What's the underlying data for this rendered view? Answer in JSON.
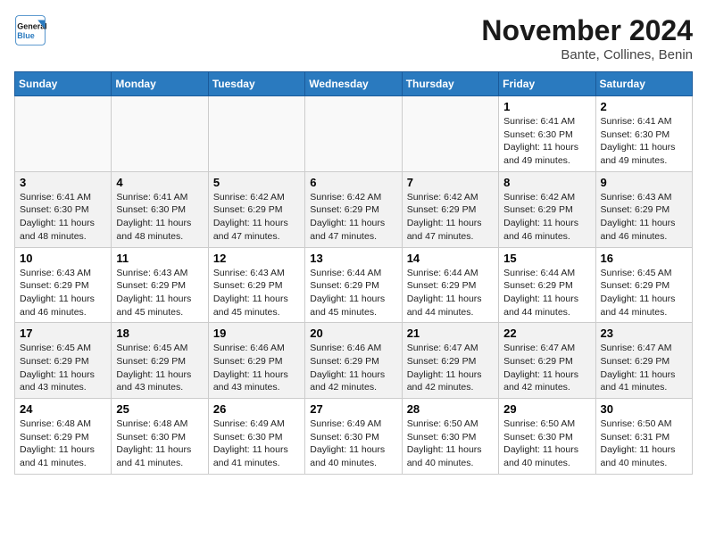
{
  "logo": {
    "line1": "General",
    "line2": "Blue"
  },
  "title": "November 2024",
  "location": "Bante, Collines, Benin",
  "weekdays": [
    "Sunday",
    "Monday",
    "Tuesday",
    "Wednesday",
    "Thursday",
    "Friday",
    "Saturday"
  ],
  "weeks": [
    [
      {
        "day": "",
        "info": ""
      },
      {
        "day": "",
        "info": ""
      },
      {
        "day": "",
        "info": ""
      },
      {
        "day": "",
        "info": ""
      },
      {
        "day": "",
        "info": ""
      },
      {
        "day": "1",
        "info": "Sunrise: 6:41 AM\nSunset: 6:30 PM\nDaylight: 11 hours and 49 minutes."
      },
      {
        "day": "2",
        "info": "Sunrise: 6:41 AM\nSunset: 6:30 PM\nDaylight: 11 hours and 49 minutes."
      }
    ],
    [
      {
        "day": "3",
        "info": "Sunrise: 6:41 AM\nSunset: 6:30 PM\nDaylight: 11 hours and 48 minutes."
      },
      {
        "day": "4",
        "info": "Sunrise: 6:41 AM\nSunset: 6:30 PM\nDaylight: 11 hours and 48 minutes."
      },
      {
        "day": "5",
        "info": "Sunrise: 6:42 AM\nSunset: 6:29 PM\nDaylight: 11 hours and 47 minutes."
      },
      {
        "day": "6",
        "info": "Sunrise: 6:42 AM\nSunset: 6:29 PM\nDaylight: 11 hours and 47 minutes."
      },
      {
        "day": "7",
        "info": "Sunrise: 6:42 AM\nSunset: 6:29 PM\nDaylight: 11 hours and 47 minutes."
      },
      {
        "day": "8",
        "info": "Sunrise: 6:42 AM\nSunset: 6:29 PM\nDaylight: 11 hours and 46 minutes."
      },
      {
        "day": "9",
        "info": "Sunrise: 6:43 AM\nSunset: 6:29 PM\nDaylight: 11 hours and 46 minutes."
      }
    ],
    [
      {
        "day": "10",
        "info": "Sunrise: 6:43 AM\nSunset: 6:29 PM\nDaylight: 11 hours and 46 minutes."
      },
      {
        "day": "11",
        "info": "Sunrise: 6:43 AM\nSunset: 6:29 PM\nDaylight: 11 hours and 45 minutes."
      },
      {
        "day": "12",
        "info": "Sunrise: 6:43 AM\nSunset: 6:29 PM\nDaylight: 11 hours and 45 minutes."
      },
      {
        "day": "13",
        "info": "Sunrise: 6:44 AM\nSunset: 6:29 PM\nDaylight: 11 hours and 45 minutes."
      },
      {
        "day": "14",
        "info": "Sunrise: 6:44 AM\nSunset: 6:29 PM\nDaylight: 11 hours and 44 minutes."
      },
      {
        "day": "15",
        "info": "Sunrise: 6:44 AM\nSunset: 6:29 PM\nDaylight: 11 hours and 44 minutes."
      },
      {
        "day": "16",
        "info": "Sunrise: 6:45 AM\nSunset: 6:29 PM\nDaylight: 11 hours and 44 minutes."
      }
    ],
    [
      {
        "day": "17",
        "info": "Sunrise: 6:45 AM\nSunset: 6:29 PM\nDaylight: 11 hours and 43 minutes."
      },
      {
        "day": "18",
        "info": "Sunrise: 6:45 AM\nSunset: 6:29 PM\nDaylight: 11 hours and 43 minutes."
      },
      {
        "day": "19",
        "info": "Sunrise: 6:46 AM\nSunset: 6:29 PM\nDaylight: 11 hours and 43 minutes."
      },
      {
        "day": "20",
        "info": "Sunrise: 6:46 AM\nSunset: 6:29 PM\nDaylight: 11 hours and 42 minutes."
      },
      {
        "day": "21",
        "info": "Sunrise: 6:47 AM\nSunset: 6:29 PM\nDaylight: 11 hours and 42 minutes."
      },
      {
        "day": "22",
        "info": "Sunrise: 6:47 AM\nSunset: 6:29 PM\nDaylight: 11 hours and 42 minutes."
      },
      {
        "day": "23",
        "info": "Sunrise: 6:47 AM\nSunset: 6:29 PM\nDaylight: 11 hours and 41 minutes."
      }
    ],
    [
      {
        "day": "24",
        "info": "Sunrise: 6:48 AM\nSunset: 6:29 PM\nDaylight: 11 hours and 41 minutes."
      },
      {
        "day": "25",
        "info": "Sunrise: 6:48 AM\nSunset: 6:30 PM\nDaylight: 11 hours and 41 minutes."
      },
      {
        "day": "26",
        "info": "Sunrise: 6:49 AM\nSunset: 6:30 PM\nDaylight: 11 hours and 41 minutes."
      },
      {
        "day": "27",
        "info": "Sunrise: 6:49 AM\nSunset: 6:30 PM\nDaylight: 11 hours and 40 minutes."
      },
      {
        "day": "28",
        "info": "Sunrise: 6:50 AM\nSunset: 6:30 PM\nDaylight: 11 hours and 40 minutes."
      },
      {
        "day": "29",
        "info": "Sunrise: 6:50 AM\nSunset: 6:30 PM\nDaylight: 11 hours and 40 minutes."
      },
      {
        "day": "30",
        "info": "Sunrise: 6:50 AM\nSunset: 6:31 PM\nDaylight: 11 hours and 40 minutes."
      }
    ]
  ]
}
